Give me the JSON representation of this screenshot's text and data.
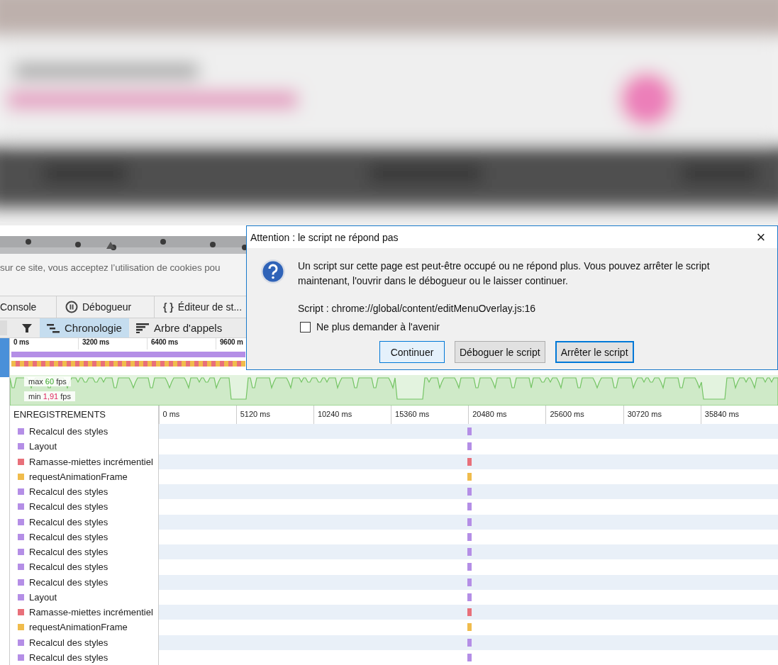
{
  "cookie_banner": {
    "text": "sur ce site, vous acceptez l’utilisation de cookies pou"
  },
  "devtools": {
    "tabs": [
      {
        "label": "Console",
        "selected": false
      },
      {
        "label": "Débogueur",
        "selected": false
      },
      {
        "label": "Éditeur de st...",
        "glyph": "{ }",
        "selected": false
      }
    ],
    "views": [
      {
        "label": "Chronologie",
        "selected": true
      },
      {
        "label": "Arbre d'appels",
        "selected": false
      }
    ],
    "overview": {
      "ticks": [
        "0 ms",
        "3200 ms",
        "6400 ms",
        "9600 m"
      ],
      "fps_max": {
        "label": "max",
        "value": "60",
        "unit": "fps"
      },
      "fps_min": {
        "label": "min",
        "value": "1,91",
        "unit": "fps"
      }
    },
    "waterfall": {
      "header": "ENREGISTREMENTS",
      "ticks": [
        "0 ms",
        "5120 ms",
        "10240 ms",
        "15360 ms",
        "20480 ms",
        "25600 ms",
        "30720 ms",
        "35840 ms"
      ],
      "rows": [
        {
          "name": "Recalcul des styles",
          "color": "#b48ee6"
        },
        {
          "name": "Layout",
          "color": "#b48ee6"
        },
        {
          "name": "Ramasse-miettes incrémentiel",
          "color": "#e8707a"
        },
        {
          "name": "requestAnimationFrame",
          "color": "#f0bc4c"
        },
        {
          "name": "Recalcul des styles",
          "color": "#b48ee6"
        },
        {
          "name": "Recalcul des styles",
          "color": "#b48ee6"
        },
        {
          "name": "Recalcul des styles",
          "color": "#b48ee6"
        },
        {
          "name": "Recalcul des styles",
          "color": "#b48ee6"
        },
        {
          "name": "Recalcul des styles",
          "color": "#b48ee6"
        },
        {
          "name": "Recalcul des styles",
          "color": "#b48ee6"
        },
        {
          "name": "Recalcul des styles",
          "color": "#b48ee6"
        },
        {
          "name": "Layout",
          "color": "#b48ee6"
        },
        {
          "name": "Ramasse-miettes incrémentiel",
          "color": "#e8707a"
        },
        {
          "name": "requestAnimationFrame",
          "color": "#f0bc4c"
        },
        {
          "name": "Recalcul des styles",
          "color": "#b48ee6"
        },
        {
          "name": "Recalcul des styles",
          "color": "#b48ee6"
        }
      ]
    }
  },
  "dialog": {
    "title": "Attention : le script ne répond pas",
    "close": "×",
    "message": "Un script sur cette page est peut-être occupé ou ne répond plus. Vous pouvez arrêter le script maintenant, l'ouvrir dans le débogueur ou le laisser continuer.",
    "script": "Script : chrome://global/content/editMenuOverlay.js:16",
    "checkbox": {
      "label": "Ne plus demander à l'avenir",
      "checked": false
    },
    "buttons": [
      {
        "label": "Continuer",
        "kind": "focused"
      },
      {
        "label": "Déboguer le script",
        "kind": "normal"
      },
      {
        "label": "Arrêter le script",
        "kind": "default"
      }
    ]
  }
}
